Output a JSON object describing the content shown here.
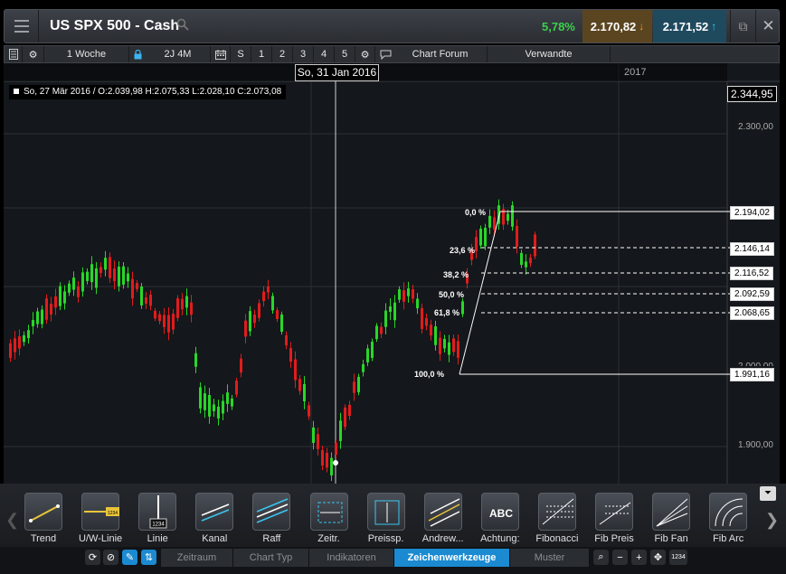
{
  "window": {
    "instrument": "US SPX 500 - Cash",
    "change_pct": "5,78%",
    "sell_price": "2.170,82",
    "buy_price": "2.171,52"
  },
  "toolbar": {
    "interval": "1 Woche",
    "range": "2J 4M",
    "s_label": "S",
    "n1": "1",
    "n2": "2",
    "n3": "3",
    "n4": "4",
    "n5": "5",
    "chart_forum": "Chart Forum",
    "related": "Verwandte"
  },
  "chart": {
    "crosshair_date": "So, 31 Jan 2016",
    "year_label": "2017",
    "ohlc": "So, 27 Mär 2016 / O:2.039,98  H:2.075,33  L:2.028,10  C:2.073,08",
    "current_price": "2.344,95",
    "y_ticks": [
      {
        "label": "2.300,00"
      },
      {
        "label": "1.900,00"
      },
      {
        "label": "2.000,00"
      }
    ],
    "fib_levels": [
      {
        "pct": "0,0 %",
        "price": "2.194,02"
      },
      {
        "pct": "23,6 %",
        "price": "2.146,14"
      },
      {
        "pct": "38,2 %",
        "price": "2.116,52"
      },
      {
        "pct": "50,0 %",
        "price": "2.092,59"
      },
      {
        "pct": "61,8 %",
        "price": "2.068,65"
      },
      {
        "pct": "100,0 %",
        "price": "1.991,16"
      }
    ],
    "colors": {
      "up": "#28d728",
      "down": "#e21c1c",
      "background": "#14171b"
    }
  },
  "tools": [
    {
      "label": "Trend",
      "icon": "trend-line-icon"
    },
    {
      "label": "U/W-Linie",
      "icon": "horizontal-line-icon",
      "tag": "1234"
    },
    {
      "label": "Linie",
      "icon": "vertical-line-icon",
      "tag": "1234"
    },
    {
      "label": "Kanal",
      "icon": "channel-icon"
    },
    {
      "label": "Raff",
      "icon": "raff-channel-icon"
    },
    {
      "label": "Zeitr.",
      "icon": "time-range-icon"
    },
    {
      "label": "Preissp.",
      "icon": "price-range-icon"
    },
    {
      "label": "Andrew...",
      "icon": "andrews-pitchfork-icon"
    },
    {
      "label": "Achtung:",
      "icon": "text-annotation-icon",
      "tag": "ABC"
    },
    {
      "label": "Fibonacci",
      "icon": "fibonacci-icon"
    },
    {
      "label": "Fib Preis",
      "icon": "fib-price-icon"
    },
    {
      "label": "Fib Fan",
      "icon": "fib-fan-icon"
    },
    {
      "label": "Fib Arc",
      "icon": "fib-arc-icon"
    }
  ],
  "bottom": {
    "tabs": [
      "Zeitraum",
      "Chart Typ",
      "Indikatoren",
      "Zeichenwerkzeuge",
      "Muster"
    ],
    "active_tab": "Zeichenwerkzeuge",
    "zoom_tag": "1234"
  }
}
